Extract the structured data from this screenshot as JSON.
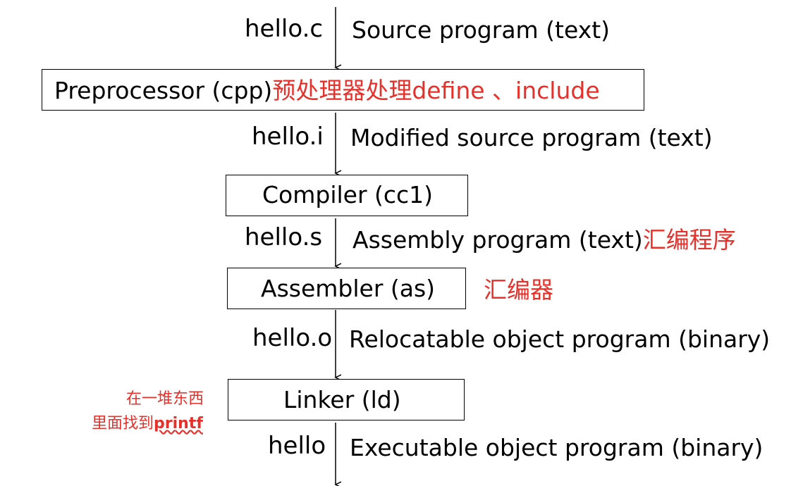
{
  "flow": [
    {
      "file": "hello.c",
      "description": "Source program (text)",
      "description_note": ""
    },
    {
      "file": "hello.i",
      "description": "Modified source program (text)",
      "description_note": ""
    },
    {
      "file": "hello.s",
      "description": "Assembly program (text)",
      "description_note": "汇编程序"
    },
    {
      "file": "hello.o",
      "description": "Relocatable object program (binary)",
      "description_note": ""
    },
    {
      "file": "hello",
      "description": "Executable object program (binary)",
      "description_note": ""
    }
  ],
  "stages": [
    {
      "label": "Preprocessor (cpp)",
      "note": "预处理器处理define 、include"
    },
    {
      "label": "Compiler (cc1)",
      "note": ""
    },
    {
      "label": "Assembler (as)",
      "note": "汇编器"
    },
    {
      "label": "Linker (ld)",
      "note": ""
    }
  ],
  "linker_note": {
    "line1": "在一堆东西",
    "line2_prefix": "里面找到",
    "line2_emphasis": "printf"
  },
  "colors": {
    "annotation": "#e8302a",
    "line": "#000000"
  }
}
